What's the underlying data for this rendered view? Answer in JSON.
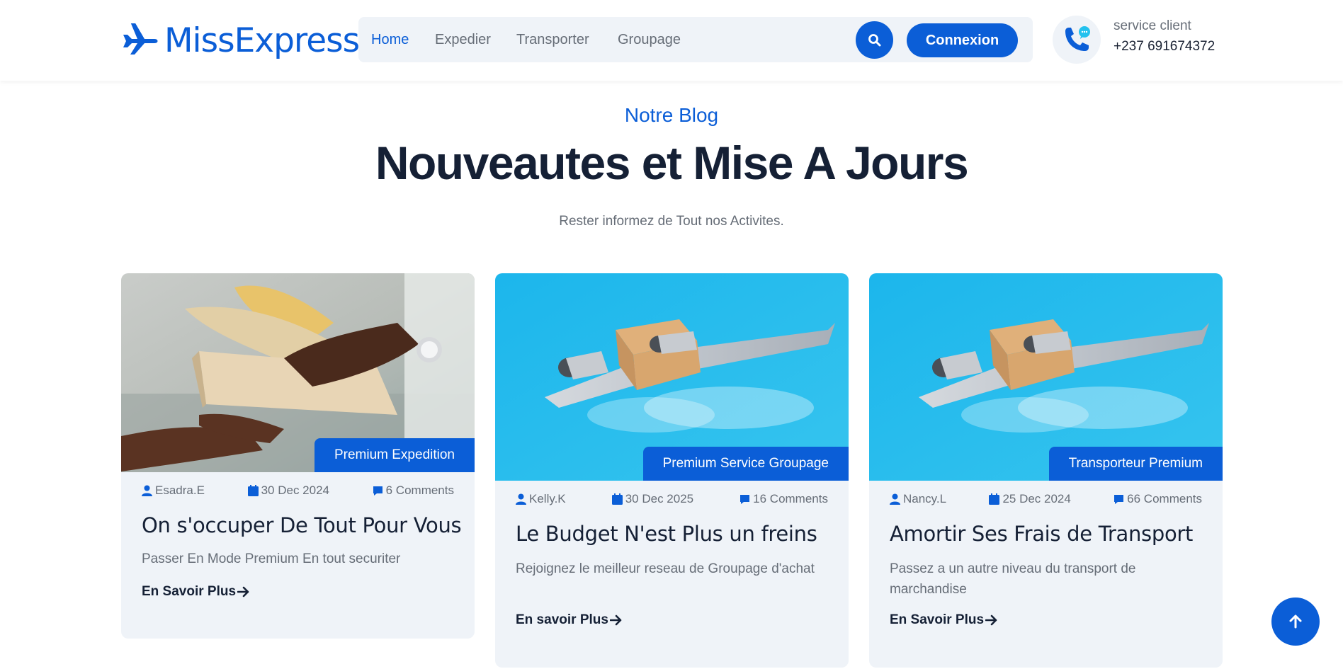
{
  "header": {
    "brand": "MissExpress",
    "nav": [
      {
        "label": "Home",
        "active": true
      },
      {
        "label": "Expedier",
        "active": false
      },
      {
        "label": "Transporter",
        "active": false
      },
      {
        "label": "Groupage",
        "active": false
      }
    ],
    "login_label": "Connexion",
    "service_label": "service client",
    "service_phone": "+237 691674372"
  },
  "section": {
    "eyebrow": "Notre Blog",
    "title": "Nouveautes et Mise A Jours",
    "subtitle": "Rester informez de Tout nos Activites."
  },
  "cards": [
    {
      "tag": "Premium Expedition",
      "author": "Esadra.E",
      "date": "30 Dec 2024",
      "comments": "6 Comments",
      "title": "On s'occuper De Tout Pour Vous",
      "desc": "Passer En Mode Premium En tout securiter",
      "link": "En Savoir Plus"
    },
    {
      "tag": "Premium Service Groupage",
      "author": "Kelly.K",
      "date": "30 Dec 2025",
      "comments": "16 Comments",
      "title": "Le Budget N'est Plus un freins",
      "desc": "Rejoignez le meilleur reseau de Groupage d'achat",
      "link": "En savoir Plus"
    },
    {
      "tag": "Transporteur Premium",
      "author": "Nancy.L",
      "date": "25 Dec 2024",
      "comments": "66 Comments",
      "title": "Amortir Ses Frais de Transport",
      "desc": "Passez a un autre niveau du transport de marchandise",
      "link": "En Savoir Plus"
    }
  ],
  "colors": {
    "accent": "#0b5ed7",
    "heading": "#152035",
    "muted": "#666d77",
    "card_bg": "#eff3f8",
    "sky": "#22c1ee"
  }
}
